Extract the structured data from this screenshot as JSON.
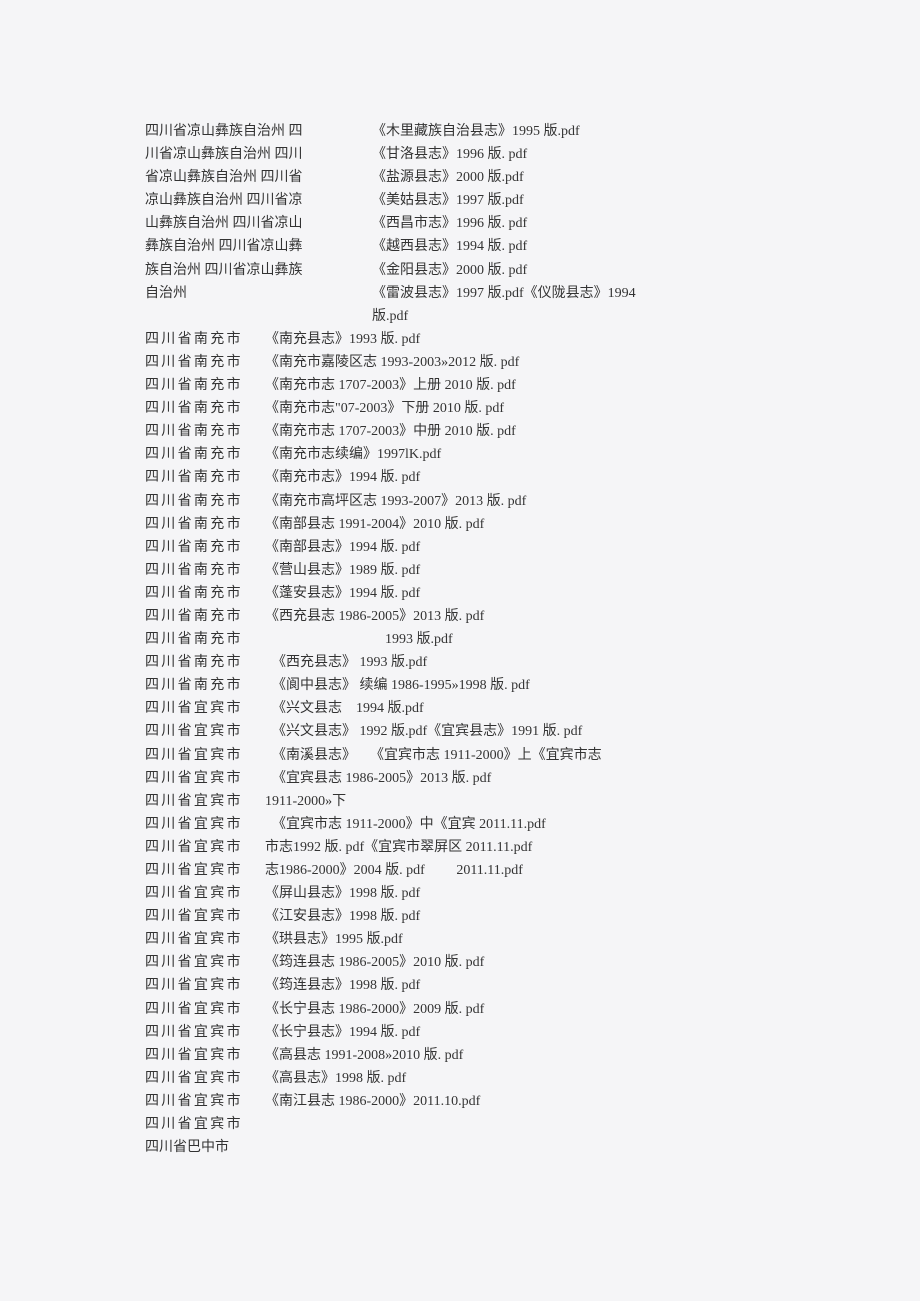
{
  "block1": {
    "left": [
      "四川省凉山彝族自治州 四",
      "川省凉山彝族自治州 四川",
      "省凉山彝族自治州 四川省",
      "凉山彝族自治州 四川省凉",
      "山彝族自治州 四川省凉山",
      "彝族自治州 四川省凉山彝",
      "族自治州 四川省凉山彝族",
      "自治州"
    ],
    "right": [
      "《木里藏族自治县志》1995 版.pdf",
      "《甘洛县志》1996 版. pdf",
      "《盐源县志》2000 版.pdf",
      "《美姑县志》1997 版.pdf",
      "《西昌市志》1996 版. pdf",
      "《越西县志》1994 版. pdf",
      "《金阳县志》2000 版. pdf",
      "《雷波县志》1997 版.pdf《仪陇县志》1994",
      "版.pdf"
    ]
  },
  "block2": [
    {
      "left": "四川省南充市",
      "right": "《南充县志》1993 版. pdf",
      "sparse": true
    },
    {
      "left": "四川省南充市",
      "right": "《南充市嘉陵区志 1993-2003»2012 版. pdf",
      "sparse": true
    },
    {
      "left": "四川省南充市",
      "right": "《南充市志 1707-2003》上册 2010 版. pdf",
      "sparse": true
    },
    {
      "left": "四川省南充市",
      "right": "《南充市志\"07-2003》下册 2010 版. pdf",
      "sparse": true
    },
    {
      "left": "四川省南充市",
      "right": "《南充市志 1707-2003》中册 2010 版. pdf",
      "sparse": true
    },
    {
      "left": "四川省南充市",
      "right": "《南充市志续编》1997lK.pdf",
      "sparse": true
    },
    {
      "left": "四川省南充市",
      "right": "《南充市志》1994 版. pdf",
      "sparse": true
    },
    {
      "left": "四川省南充市",
      "right": "《南充市高坪区志 1993-2007》2013 版. pdf",
      "sparse": true
    },
    {
      "left": "四川省南充市",
      "right": "《南部县志 1991-2004》2010 版. pdf",
      "sparse": true
    },
    {
      "left": "四川省南充市",
      "right": "《南部县志》1994 版. pdf",
      "sparse": true
    },
    {
      "left": "四川省南充市",
      "right": "《营山县志》1989 版. pdf",
      "sparse": true
    },
    {
      "left": "四川省南充市",
      "right": "《蓬安县志》1994 版. pdf",
      "sparse": true
    },
    {
      "left": "四川省南充市",
      "right": "《西充县志 1986-2005》2013 版. pdf",
      "sparse": true
    }
  ],
  "block3": [
    {
      "left": "四川省南充市",
      "right": "1993 版.pdf",
      "sparse": true,
      "offset": true
    },
    {
      "left": "四川省南充市",
      "right": "  《西充县志》 1993 版.pdf",
      "sparse": true
    },
    {
      "left": "四川省南充市",
      "right": "  《阆中县志》 续编 1986-1995»1998 版. pdf",
      "sparse": true
    },
    {
      "left": "四川省宜宾市",
      "right": "  《兴文县志    1994 版.pdf",
      "sparse": true
    },
    {
      "left": "四川省宜宾市",
      "right": "  《兴文县志》 1992 版.pdf《宜宾县志》1991 版. pdf",
      "sparse": true
    },
    {
      "left": "四川省宜宾市",
      "right": "  《南溪县志》    《宜宾市志 1911-2000》上《宜宾市志",
      "sparse": true
    },
    {
      "left": "四川省宜宾市",
      "right": "  《宜宾县志 1986-2005》2013 版. pdf",
      "sparse": true
    },
    {
      "left": "四川省宜宾市",
      "right": "1911-2000»下",
      "sparse": true,
      "nogap": true
    },
    {
      "left": "四川省宜宾市",
      "right": "  《宜宾市志 1911-2000》中《宜宾 2011.11.pdf",
      "sparse": true
    },
    {
      "left": "四川省宜宾市",
      "right": "市志1992 版. pdf《宜宾市翠屏区 2011.11.pdf",
      "sparse": true,
      "nogap": true
    },
    {
      "left": "四川省宜宾市",
      "right": "志1986-2000》2004 版. pdf         2011.11.pdf",
      "sparse": true,
      "nogap": true
    },
    {
      "left": "四川省宜宾市",
      "right": "《屏山县志》1998 版. pdf",
      "sparse": true,
      "nogap": true
    },
    {
      "left": "四川省宜宾市",
      "right": "《江安县志》1998 版. pdf",
      "sparse": true,
      "nogap": true
    },
    {
      "left": "四川省宜宾市",
      "right": "《珙县志》1995 版.pdf",
      "sparse": true,
      "nogap": true
    },
    {
      "left": "四川省宜宾市",
      "right": "《筠连县志 1986-2005》2010 版. pdf",
      "sparse": true,
      "nogap": true
    },
    {
      "left": "四川省宜宾市",
      "right": "《筠连县志》1998 版. pdf",
      "sparse": true,
      "nogap": true
    },
    {
      "left": "四川省宜宾市",
      "right": "《长宁县志 1986-2000》2009 版. pdf",
      "sparse": true,
      "nogap": true
    },
    {
      "left": "四川省宜宾市",
      "right": "《长宁县志》1994 版. pdf",
      "sparse": true,
      "nogap": true
    },
    {
      "left": "四川省宜宾市",
      "right": "《高县志 1991-2008»2010 版. pdf",
      "sparse": true,
      "nogap": true
    },
    {
      "left": "四川省宜宾市",
      "right": "《高县志》1998 版. pdf",
      "sparse": true,
      "nogap": true
    },
    {
      "left": "四川省宜宾市",
      "right": "《南江县志 1986-2000》2011.10.pdf",
      "sparse": true,
      "nogap": true
    },
    {
      "left": "四川省宜宾市",
      "right": "",
      "sparse": true
    },
    {
      "left": "四川省巴中市",
      "right": "",
      "sparse": false
    }
  ]
}
